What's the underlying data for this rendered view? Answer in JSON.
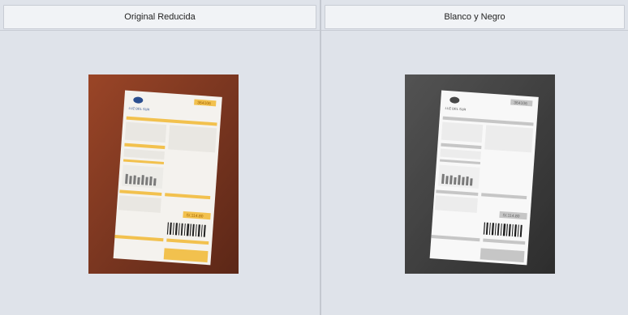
{
  "panels": [
    {
      "title": "Original Reducida"
    },
    {
      "title": "Blanco y Negro"
    }
  ],
  "receipt": {
    "brand": "LUZ DEL SUR",
    "number_badge": "364106",
    "total_badge": "S/.114.80"
  },
  "colors": {
    "background": "#dfe3ea",
    "table_surface_color": "#8a3a22",
    "accent_yellow": "#f2c14e"
  }
}
